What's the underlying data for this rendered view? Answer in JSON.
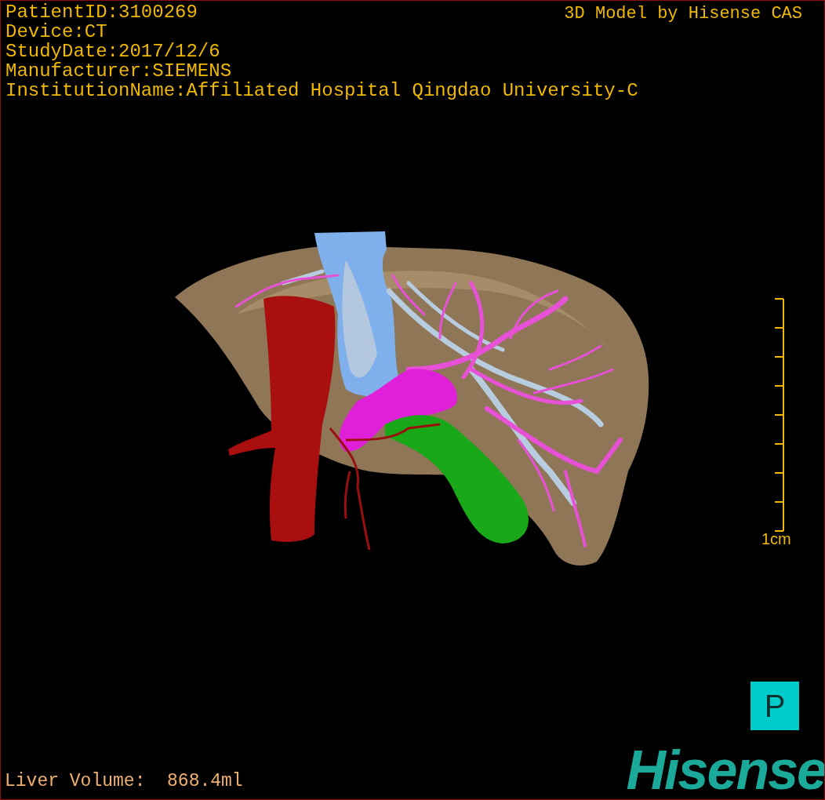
{
  "info_lines": [
    "PatientID:3100269",
    "Device:CT",
    "StudyDate:2017/12/6",
    "Manufacturer:SIEMENS",
    "InstitutionName:Affiliated Hospital Qingdao University-C"
  ],
  "title": "3D Model by Hisense CAS",
  "scale_bar": {
    "label": "1cm"
  },
  "liver_volume": "Liver Volume:  868.4ml",
  "orientation_badge": "P",
  "logo": "Hisense"
}
